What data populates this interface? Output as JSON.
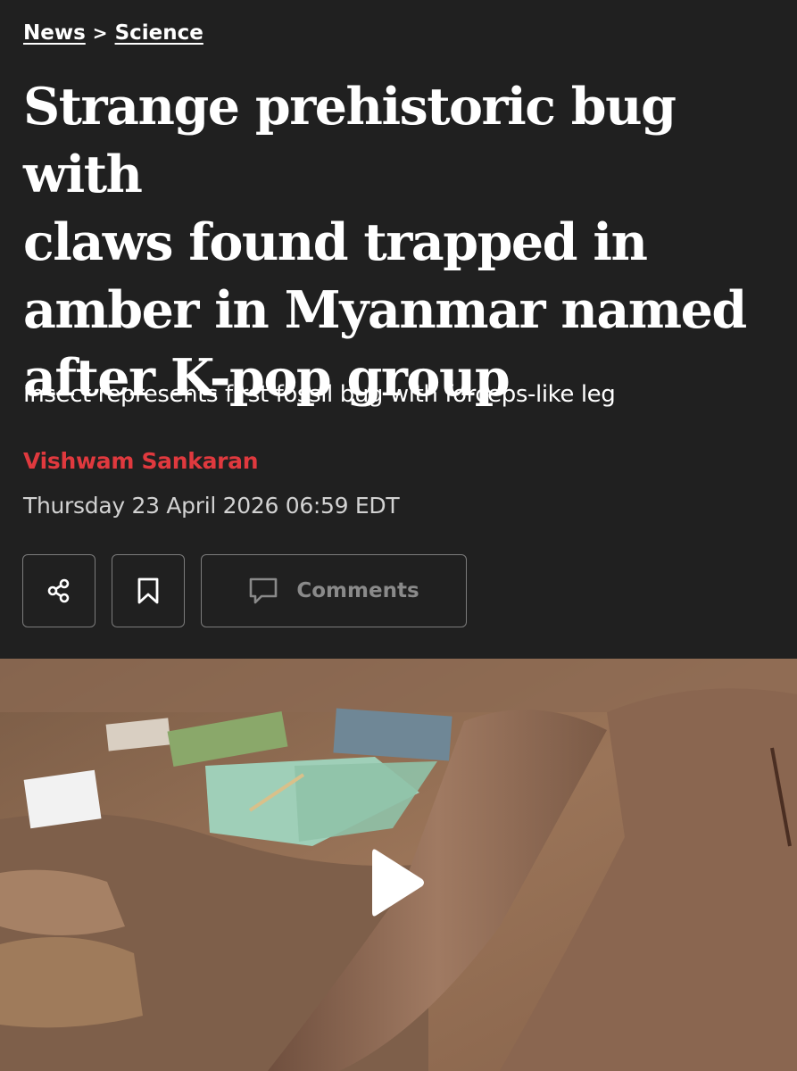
{
  "breadcrumb": {
    "section": "News",
    "separator": ">",
    "subsection": "Science"
  },
  "article": {
    "headline_lines": [
      "Strange prehistoric bug with",
      "claws found trapped in",
      "amber in Myanmar named",
      "after K-pop group"
    ],
    "standfirst": "Insect represents first fossil bug with forceps-like leg",
    "author": "Vishwam Sankaran",
    "date": "Thursday 23 April 2026 06:59 EDT"
  },
  "actions": {
    "share_icon": "share-icon",
    "bookmark_icon": "bookmark-icon",
    "comment_icon": "comment-icon",
    "comments_label": "Comments"
  },
  "media": {
    "type": "video",
    "play_icon": "play-icon"
  },
  "colors": {
    "background": "#202020",
    "byline": "#e0393e",
    "text": "#ffffff",
    "muted": "#8a8a8a"
  }
}
